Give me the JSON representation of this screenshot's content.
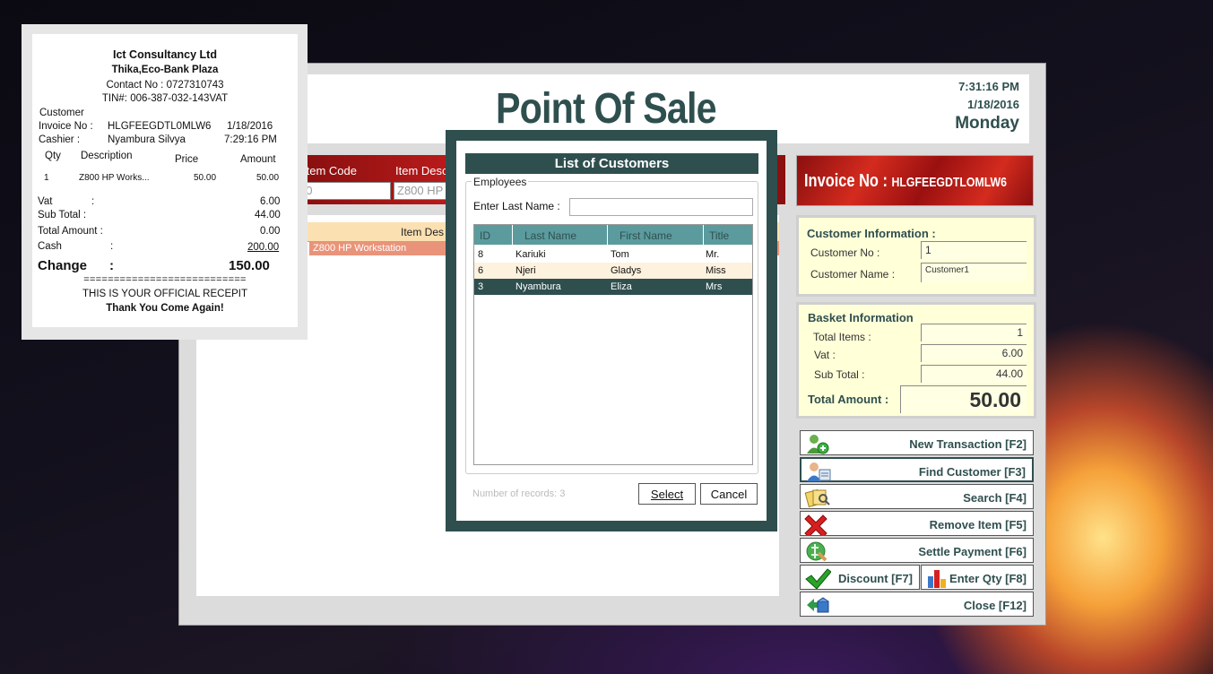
{
  "app": {
    "title": "Point Of Sale",
    "time": "7:31:16 PM",
    "date": "1/18/2016",
    "day": "Monday"
  },
  "item_entry": {
    "item_code_label": "Item Code",
    "item_desc_label": "Item Desc",
    "item_code_value": "00",
    "item_desc_value": "Z800 HP W"
  },
  "grid": {
    "header_desc": "Item Des",
    "rows": [
      {
        "description": "Z800 HP Workstation"
      }
    ]
  },
  "invoice": {
    "label": "Invoice No :",
    "number": "HLGFEEGDTLOMLW6"
  },
  "customer_info": {
    "title": "Customer Information :",
    "customer_no_label": "Customer No :",
    "customer_no": "1",
    "customer_name_label": "Customer Name :",
    "customer_name": "Customer1"
  },
  "basket_info": {
    "title": "Basket Information",
    "total_items_label": "Total Items :",
    "total_items": "1",
    "vat_label": "Vat :",
    "vat": "6.00",
    "sub_total_label": "Sub Total :",
    "sub_total": "44.00",
    "total_amount_label": "Total Amount :",
    "total_amount": "50.00"
  },
  "actions": [
    {
      "label": "New Transaction [F2]",
      "icon": "new-user-icon"
    },
    {
      "label": "Find Customer [F3]",
      "icon": "find-customer-icon"
    },
    {
      "label": "Search [F4]",
      "icon": "search-icon"
    },
    {
      "label": "Remove Item [F5]",
      "icon": "remove-icon"
    },
    {
      "label": "Settle Payment [F6]",
      "icon": "payment-icon"
    },
    {
      "label": "Discount [F7]",
      "icon": "check-icon"
    },
    {
      "label": "Enter Qty [F8]",
      "icon": "bar-chart-icon"
    },
    {
      "label": "Close [F12]",
      "icon": "close-icon"
    }
  ],
  "receipt": {
    "company": "Ict Consultancy Ltd",
    "address": "Thika,Eco-Bank Plaza",
    "contact": "Contact No : 0727310743",
    "tin": "TIN#: 006-387-032-143VAT",
    "customer_label": "Customer",
    "invoice_label": "Invoice No :",
    "invoice_no": "HLGFEEGDTL0MLW6",
    "invoice_date": "1/18/2016",
    "cashier_label": "Cashier :",
    "cashier": "Nyambura Silvya",
    "cashier_time": "7:29:16 PM",
    "col_qty": "Qty",
    "col_desc": "Description",
    "col_price": "Price",
    "col_amount": "Amount",
    "line_qty": "1",
    "line_desc": "Z800 HP Works...",
    "line_price": "50.00",
    "line_amount": "50.00",
    "vat_label": "Vat",
    "vat_colon": ":",
    "vat": "6.00",
    "sub_total_label": "Sub Total :",
    "sub_total": "44.00",
    "total_label": "Total Amount :",
    "total": "0.00",
    "cash_label": "Cash",
    "cash_colon": ":",
    "cash": "200.00",
    "change_label": "Change",
    "change_colon": ":",
    "change": "150.00",
    "separator": "===========================",
    "footer1": "THIS IS YOUR OFFICIAL RECEPIT",
    "footer2": "Thank You Come Again!"
  },
  "dialog": {
    "title": "List of Customers",
    "group_label": "Employees",
    "last_name_label": "Enter Last Name :",
    "last_name_value": "",
    "columns": [
      "ID",
      "Last Name",
      "First Name",
      "Title"
    ],
    "rows": [
      {
        "id": "8",
        "last": "Kariuki",
        "first": "Tom",
        "title": "Mr."
      },
      {
        "id": "6",
        "last": "Njeri",
        "first": "Gladys",
        "title": "Miss"
      },
      {
        "id": "3",
        "last": "Nyambura",
        "first": "Eliza",
        "title": "Mrs"
      }
    ],
    "record_count": "Number of records: 3",
    "select_label": "Select",
    "cancel_label": "Cancel"
  }
}
